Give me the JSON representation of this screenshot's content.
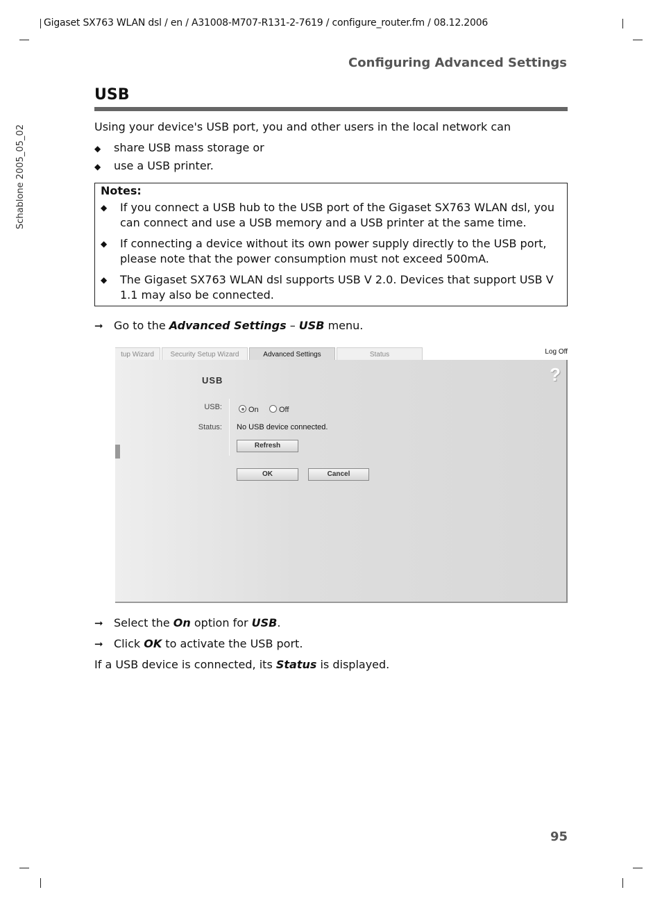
{
  "header": {
    "doc_info": "Gigaset SX763 WLAN dsl / en / A31008-M707-R131-2-7619 / configure_router.fm / 08.12.2006",
    "section": "Configuring Advanced Settings",
    "side_label": "Schablone 2005_05_02"
  },
  "page": {
    "title": "USB",
    "intro": "Using your device's USB port, you and other users in the local network can",
    "bullets": [
      "share USB mass storage or",
      "use a USB printer."
    ],
    "bullet_glyph": "◆",
    "notes": {
      "title": "Notes:",
      "items": [
        "If you connect a USB hub to the USB port of the Gigaset SX763 WLAN dsl, you can connect and use a USB memory and a USB printer at the same time.",
        "If connecting a device without its own power supply directly to the USB port, please note that the power consumption must not exceed 500mA.",
        "The Gigaset SX763 WLAN dsl supports USB V 2.0. Devices that support USB V 1.1 may also be connected."
      ]
    },
    "step1": {
      "pre": "Go to the ",
      "b1": "Advanced Settings",
      "mid": " – ",
      "b2": "USB",
      "post": " menu."
    },
    "step2": {
      "pre": "Select the ",
      "b1": "On",
      "mid": " option for ",
      "b2": "USB",
      "post": "."
    },
    "step3": {
      "pre": "Click ",
      "b1": "OK",
      "post": " to activate the USB port."
    },
    "outro": {
      "pre": "If a USB device is connected, its ",
      "b1": "Status",
      "post": " is displayed."
    },
    "arrow_glyph": "➞",
    "page_number": "95"
  },
  "screenshot": {
    "tabs": [
      {
        "label": "tup Wizard",
        "active": false
      },
      {
        "label": "Security Setup Wizard",
        "active": false
      },
      {
        "label": "Advanced Settings",
        "active": true
      },
      {
        "label": "Status",
        "active": false
      }
    ],
    "log_off": "Log Off",
    "help_glyph": "?",
    "pane_title": "USB",
    "usb_label": "USB:",
    "status_label": "Status:",
    "radio_on": "On",
    "radio_off": "Off",
    "usb_selected": "On",
    "status_value": "No USB device connected.",
    "refresh_button": "Refresh",
    "ok_button": "OK",
    "cancel_button": "Cancel"
  }
}
